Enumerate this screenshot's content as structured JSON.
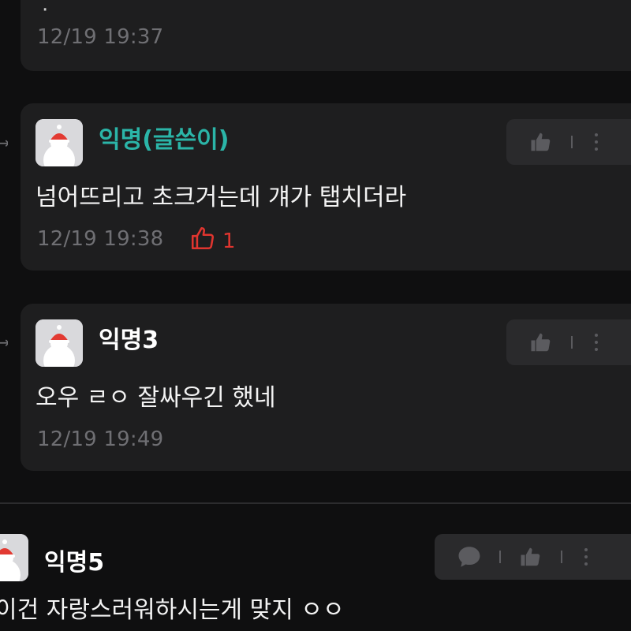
{
  "comments": [
    {
      "time": "12/19 19:37"
    },
    {
      "author": "익명(글쓴이)",
      "is_author": true,
      "text": "넘어뜨리고 초크거는데 걔가 탭치더라",
      "time": "12/19 19:38",
      "like_count": "1"
    },
    {
      "author": "익명3",
      "text": "오우 ㄹㅇ 잘싸우긴 했네",
      "time": "12/19 19:49"
    }
  ],
  "root_comment": {
    "author": "익명5",
    "text": "이건 자랑스러워하시는게 맞지 ㅇㅇ"
  },
  "icons": {
    "reply_arrow": "reply-arrow-icon",
    "like": "thumbs-up-icon",
    "more": "more-vertical-icon",
    "comment": "speech-bubble-icon"
  },
  "colors": {
    "background": "#0f0f10",
    "card": "#1e1e1f",
    "author_name": "#2bb5a8",
    "like_active": "#e0352f",
    "muted": "#6f6f73"
  }
}
